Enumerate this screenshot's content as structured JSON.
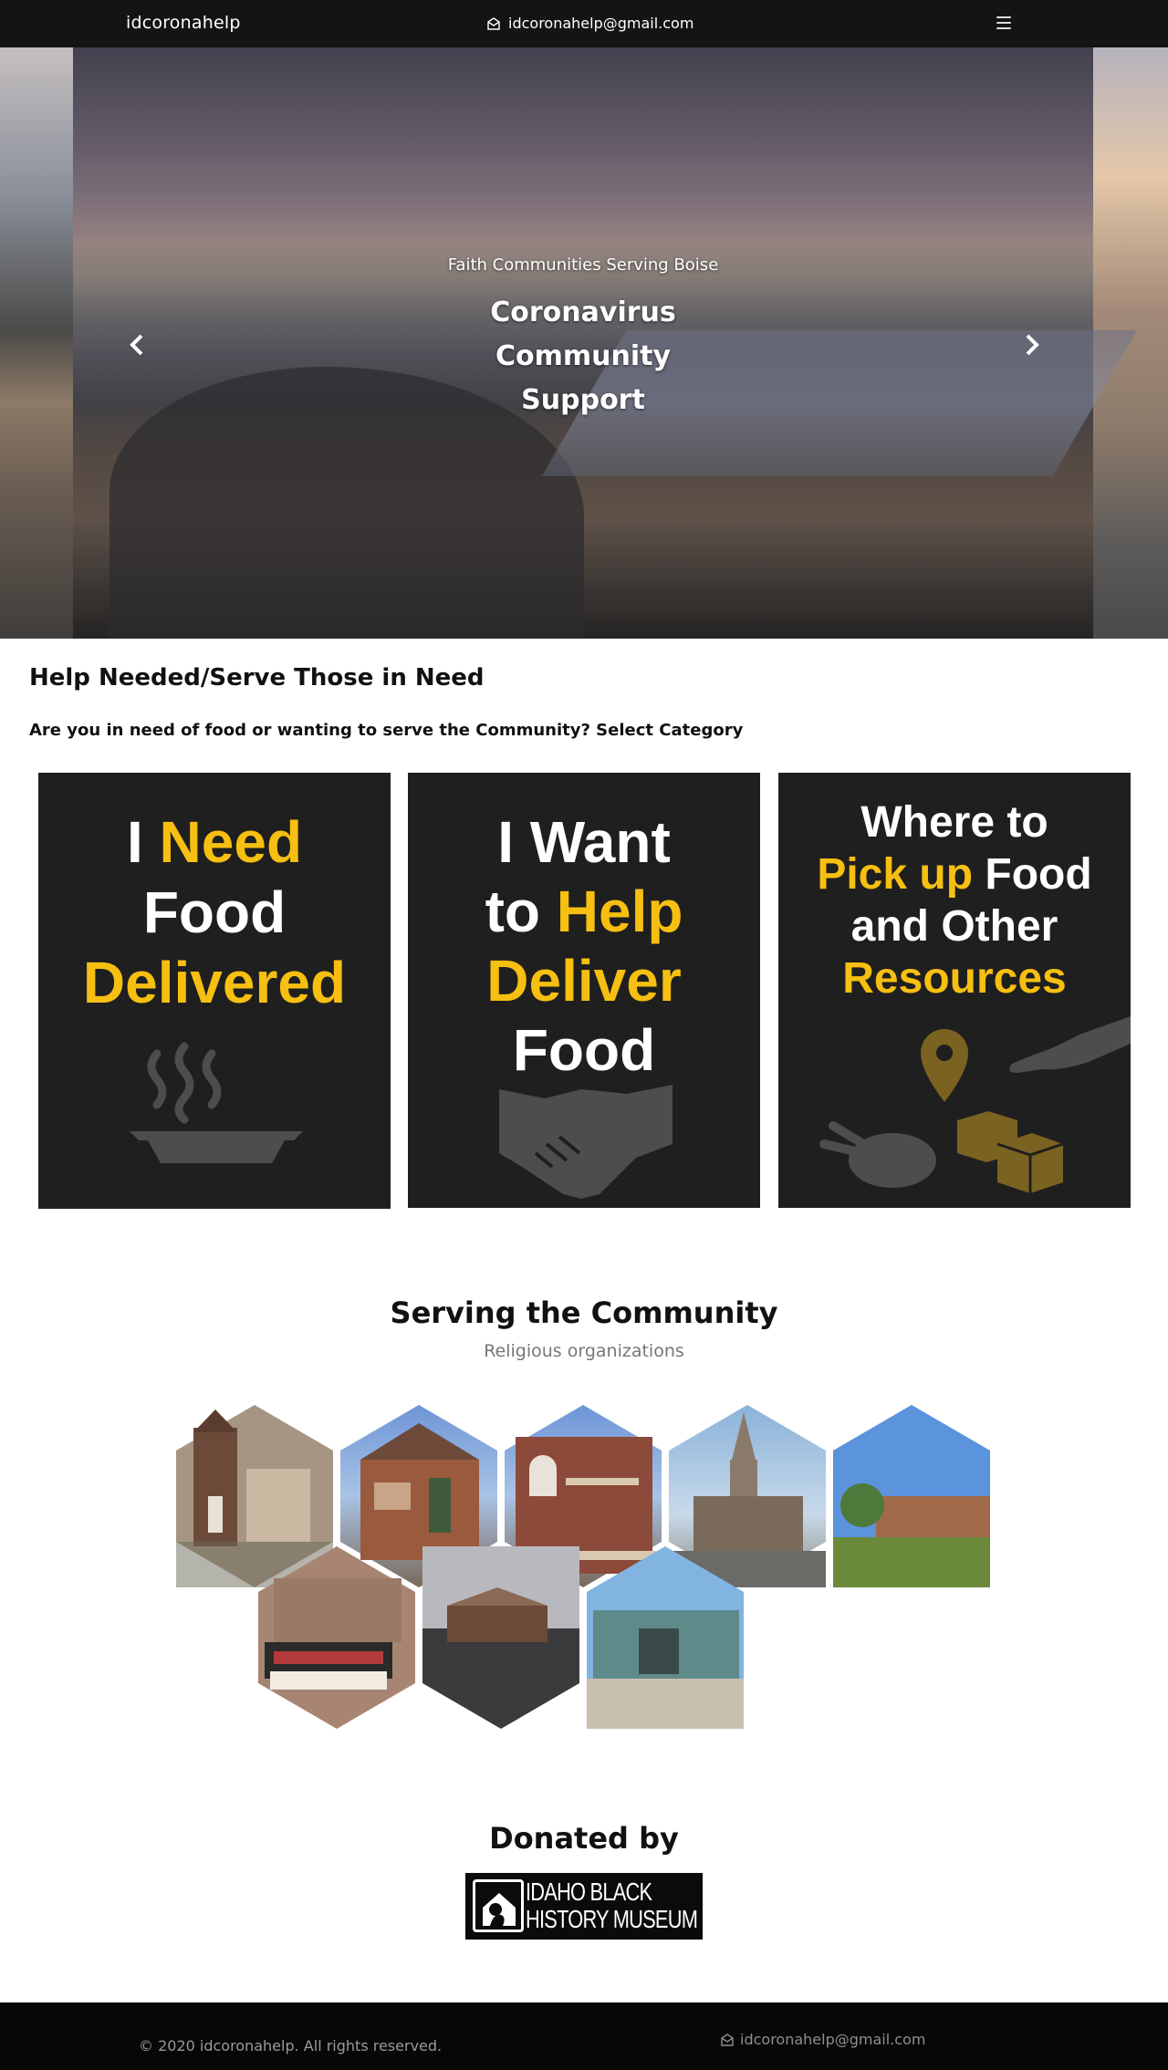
{
  "navbar": {
    "brand": "idcoronahelp",
    "email": "idcoronahelp@gmail.com",
    "menu_icon": "hamburger-icon",
    "mail_icon": "envelope-icon"
  },
  "hero": {
    "subtitle": "Faith Communities Serving Boise",
    "title_lines": [
      "Coronavirus",
      "Community",
      "Support"
    ],
    "prev_icon": "chevron-left-icon",
    "next_icon": "chevron-right-icon"
  },
  "help": {
    "title": "Help Needed/Serve Those in Need",
    "subtitle": "Are you in need of food or wanting to serve the Community? Select Category",
    "cards": [
      {
        "lines": [
          [
            "I ",
            "Need"
          ],
          [
            "Food"
          ],
          [
            "Delivered"
          ]
        ],
        "highlight": [
          "Need",
          "Delivered"
        ],
        "icon": "steaming-dish-icon"
      },
      {
        "lines": [
          [
            "I Want"
          ],
          [
            "to ",
            "Help"
          ],
          [
            "Deliver"
          ],
          [
            "Food"
          ]
        ],
        "highlight": [
          "Help",
          "Deliver"
        ],
        "icon": "handshake-icon"
      },
      {
        "lines": [
          [
            "Where to"
          ],
          [
            "Pick up",
            " Food"
          ],
          [
            "and Other"
          ],
          [
            "Resources"
          ]
        ],
        "highlight": [
          "Pick up",
          "Resources"
        ],
        "icon": "pickup-resources-icon"
      }
    ]
  },
  "serving": {
    "title": "Serving the Community",
    "subtitle": "Religious organizations",
    "organizations_count_row1": 5,
    "organizations_count_row2": 3
  },
  "donated": {
    "title": "Donated by",
    "logo_lines": [
      "IDAHO BLACK",
      "HISTORY MUSEUM"
    ]
  },
  "footer": {
    "copyright": "© 2020 idcoronahelp. All rights reserved.",
    "email": "idcoronahelp@gmail.com"
  },
  "colors": {
    "navbar": "#141414",
    "accent_yellow": "#f6bf11",
    "card_bg": "#1f1f1f",
    "footer": "#070707"
  }
}
